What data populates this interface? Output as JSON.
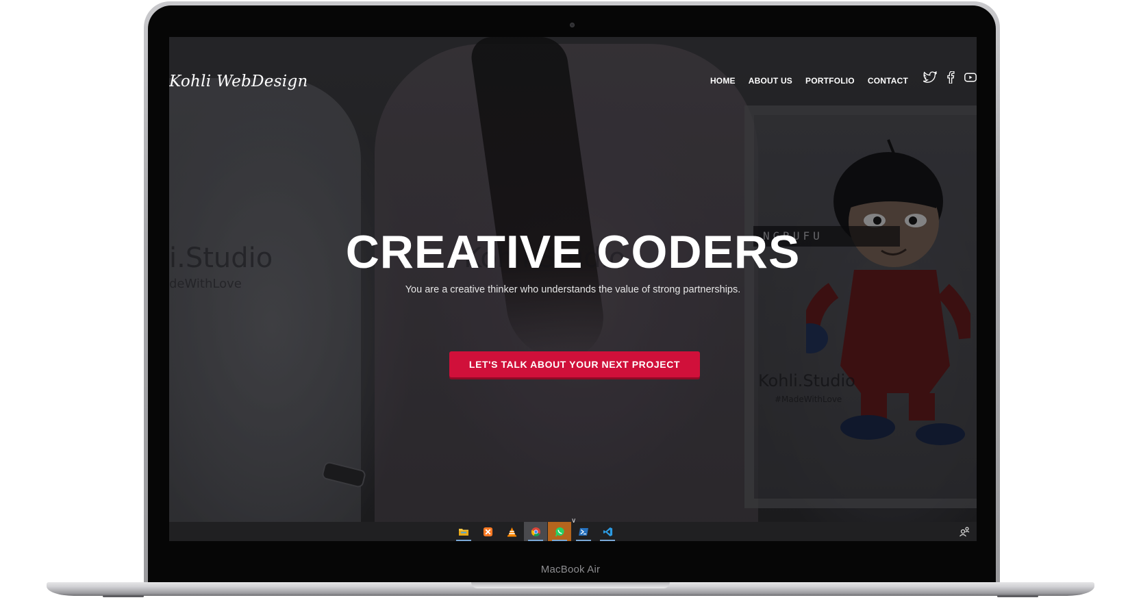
{
  "device": {
    "label": "MacBook Air"
  },
  "site": {
    "logo_text": "Kohli WebDesign",
    "nav": [
      {
        "label": "HOME"
      },
      {
        "label": "ABOUT US"
      },
      {
        "label": "PORTFOLIO"
      },
      {
        "label": "CONTACT"
      }
    ],
    "social_icons": [
      "twitter-icon",
      "facebook-icon",
      "youtube-icon"
    ],
    "hero": {
      "title": "CREATIVE CODERS",
      "subtitle": "You are a creative thinker who understands the value of strong partnerships.",
      "cta_label": "LET'S TALK ABOUT YOUR NEXT PROJECT",
      "background_prints": {
        "left_brand": "i.Studio",
        "left_tag": "deWithLove",
        "mid_brand": "Kohli.Studio",
        "right_brand": "Kohli.Studio",
        "right_tag": "#MadeWithLove",
        "banner": "NGRUFU"
      }
    },
    "colors": {
      "cta": "#d0103a",
      "text": "#ffffff"
    }
  },
  "taskbar": {
    "apps": [
      {
        "icon": "file-explorer-icon",
        "state": "running"
      },
      {
        "icon": "xampp-icon",
        "state": "idle"
      },
      {
        "icon": "vlc-icon",
        "state": "idle"
      },
      {
        "icon": "chrome-icon",
        "state": "active"
      },
      {
        "icon": "whatsapp-icon",
        "state": "highlight"
      },
      {
        "icon": "powershell-icon",
        "state": "running"
      },
      {
        "icon": "vscode-icon",
        "state": "running"
      }
    ],
    "tray_icon": "people-icon"
  }
}
